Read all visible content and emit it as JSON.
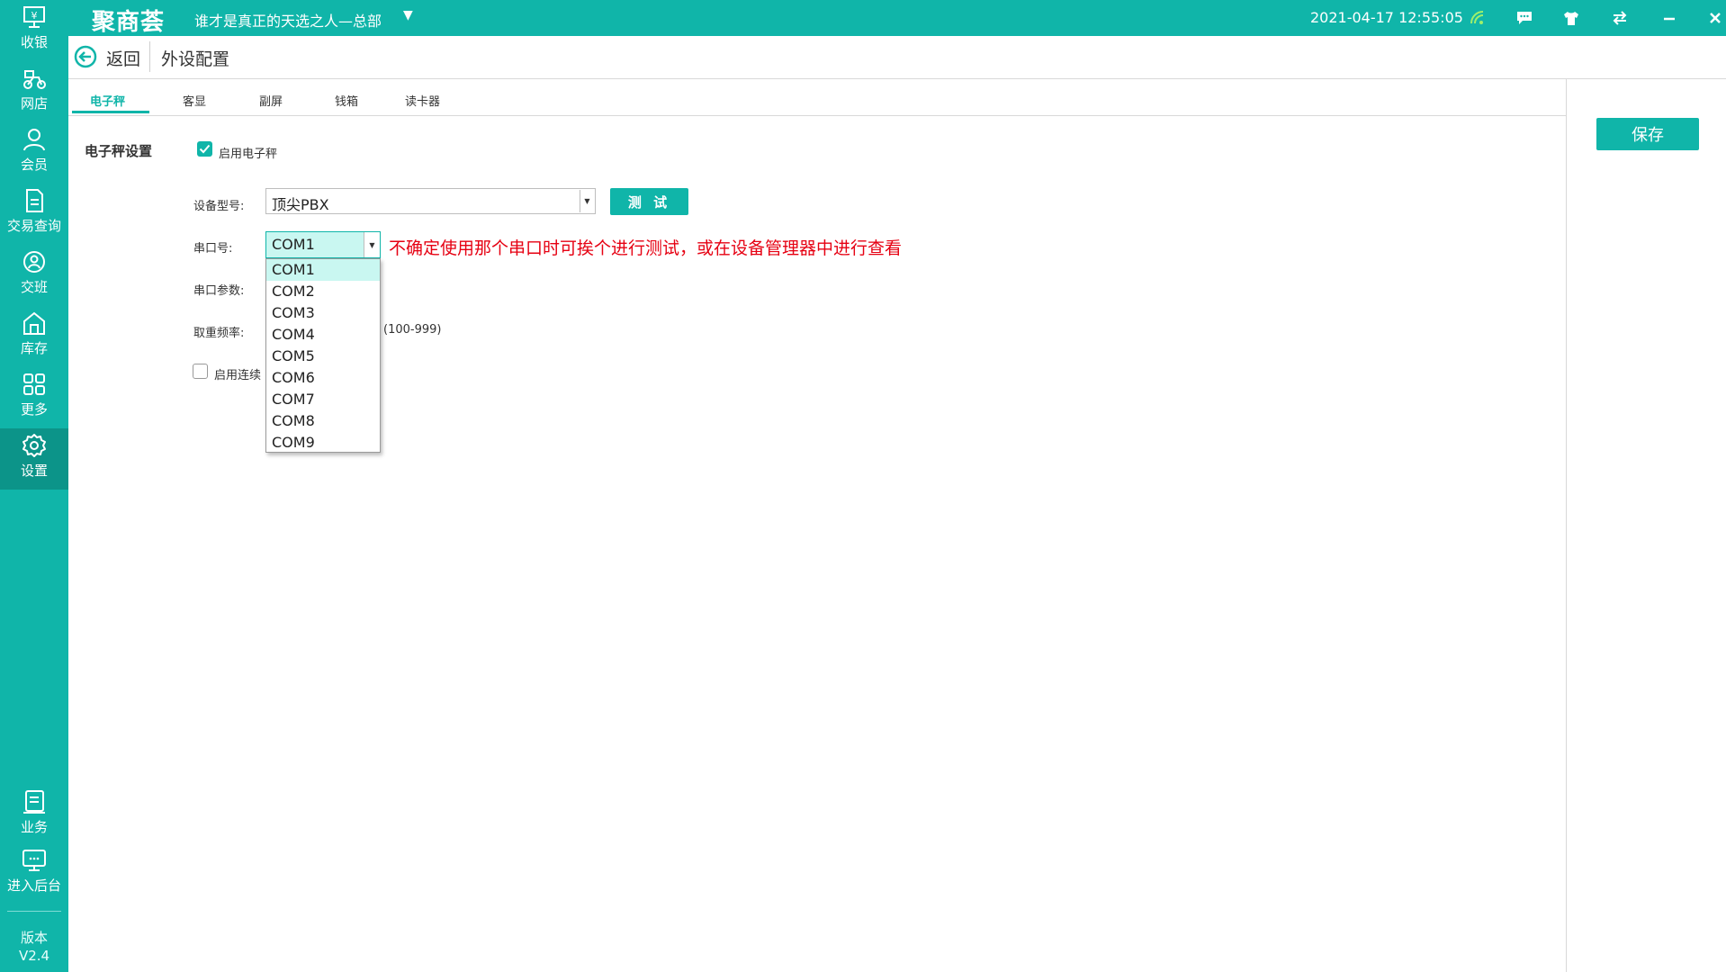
{
  "topbar": {
    "brand": "聚商荟",
    "store_name": "谁才是真正的天选之人—总部",
    "datetime": "2021-04-17 12:55:05",
    "icons": [
      "wifi-icon",
      "message-icon",
      "tshirt-icon",
      "switch-icon",
      "minimize-icon",
      "close-icon"
    ]
  },
  "sidebar": {
    "items": [
      {
        "label": "收银",
        "icon": "register-icon"
      },
      {
        "label": "网店",
        "icon": "scooter-icon"
      },
      {
        "label": "会员",
        "icon": "member-icon"
      },
      {
        "label": "交易查询",
        "icon": "document-icon"
      },
      {
        "label": "交班",
        "icon": "handover-icon"
      },
      {
        "label": "库存",
        "icon": "warehouse-icon"
      },
      {
        "label": "更多",
        "icon": "grid-icon"
      },
      {
        "label": "设置",
        "icon": "settings-icon",
        "active": true
      },
      {
        "label": "业务",
        "icon": "business-icon"
      },
      {
        "label": "进入后台",
        "icon": "monitor-icon"
      }
    ],
    "version_label": "版本",
    "version": "V2.4"
  },
  "header": {
    "back_label": "返回",
    "title": "外设配置"
  },
  "tabs": [
    "电子秤",
    "客显",
    "副屏",
    "钱箱",
    "读卡器"
  ],
  "active_tab": "电子秤",
  "save_label": "保存",
  "form": {
    "section_title": "电子秤设置",
    "enable_scale": {
      "label": "启用电子秤",
      "checked": true
    },
    "device_model": {
      "label": "设备型号:",
      "value": "顶尖PBX"
    },
    "test_label": "测 试",
    "serial_port": {
      "label": "串口号:",
      "value": "COM1"
    },
    "hint": "不确定使用那个串口时可挨个进行测试，或在设备管理器中进行查看",
    "serial_params": {
      "label": "串口参数:"
    },
    "frequency": {
      "label": "取重频率:",
      "range": "(100-999)"
    },
    "continuous": {
      "label": "启用连续",
      "checked": false
    }
  },
  "dropdown": {
    "options": [
      "COM1",
      "COM2",
      "COM3",
      "COM4",
      "COM5",
      "COM6",
      "COM7",
      "COM8",
      "COM9"
    ],
    "selected": "COM1"
  },
  "colors": {
    "accent": "#10b5a9",
    "hint": "#e60012",
    "selected_bg": "#c9f7f1"
  }
}
